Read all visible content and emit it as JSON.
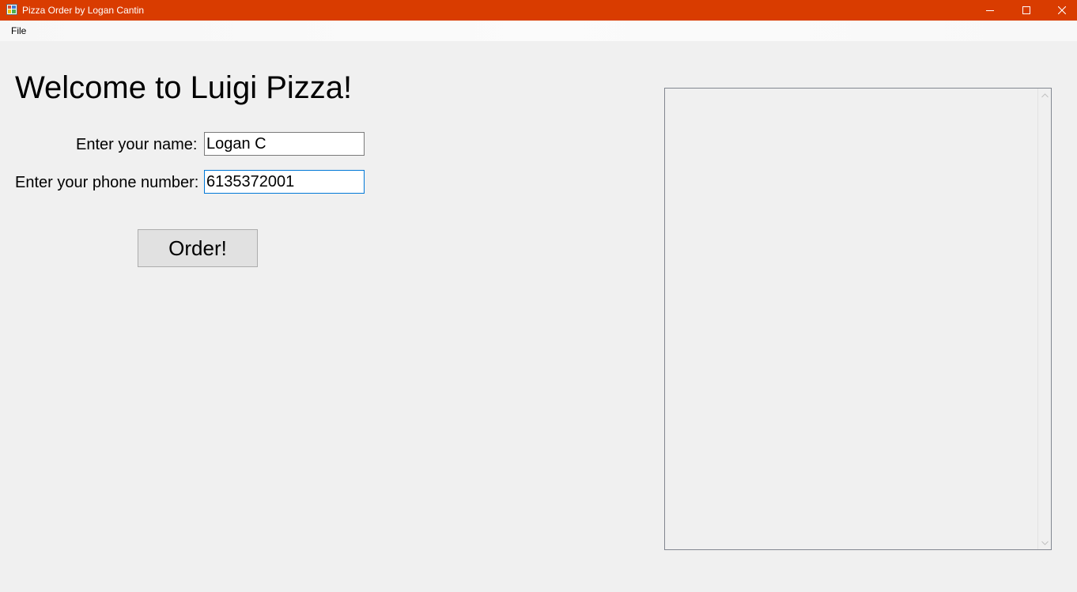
{
  "window": {
    "title": "Pizza Order by Logan Cantin",
    "accent_color": "#d93c00",
    "controls": {
      "minimize_icon": "minimize-icon",
      "maximize_icon": "maximize-icon",
      "close_icon": "close-icon"
    }
  },
  "menu": {
    "items": [
      {
        "label": "File"
      }
    ]
  },
  "form": {
    "heading": "Welcome to Luigi Pizza!",
    "name_label": "Enter your name:",
    "name_value": "Logan C",
    "phone_label": "Enter your phone number:",
    "phone_value": "6135372001",
    "order_button_label": "Order!"
  },
  "output": {
    "text": ""
  }
}
